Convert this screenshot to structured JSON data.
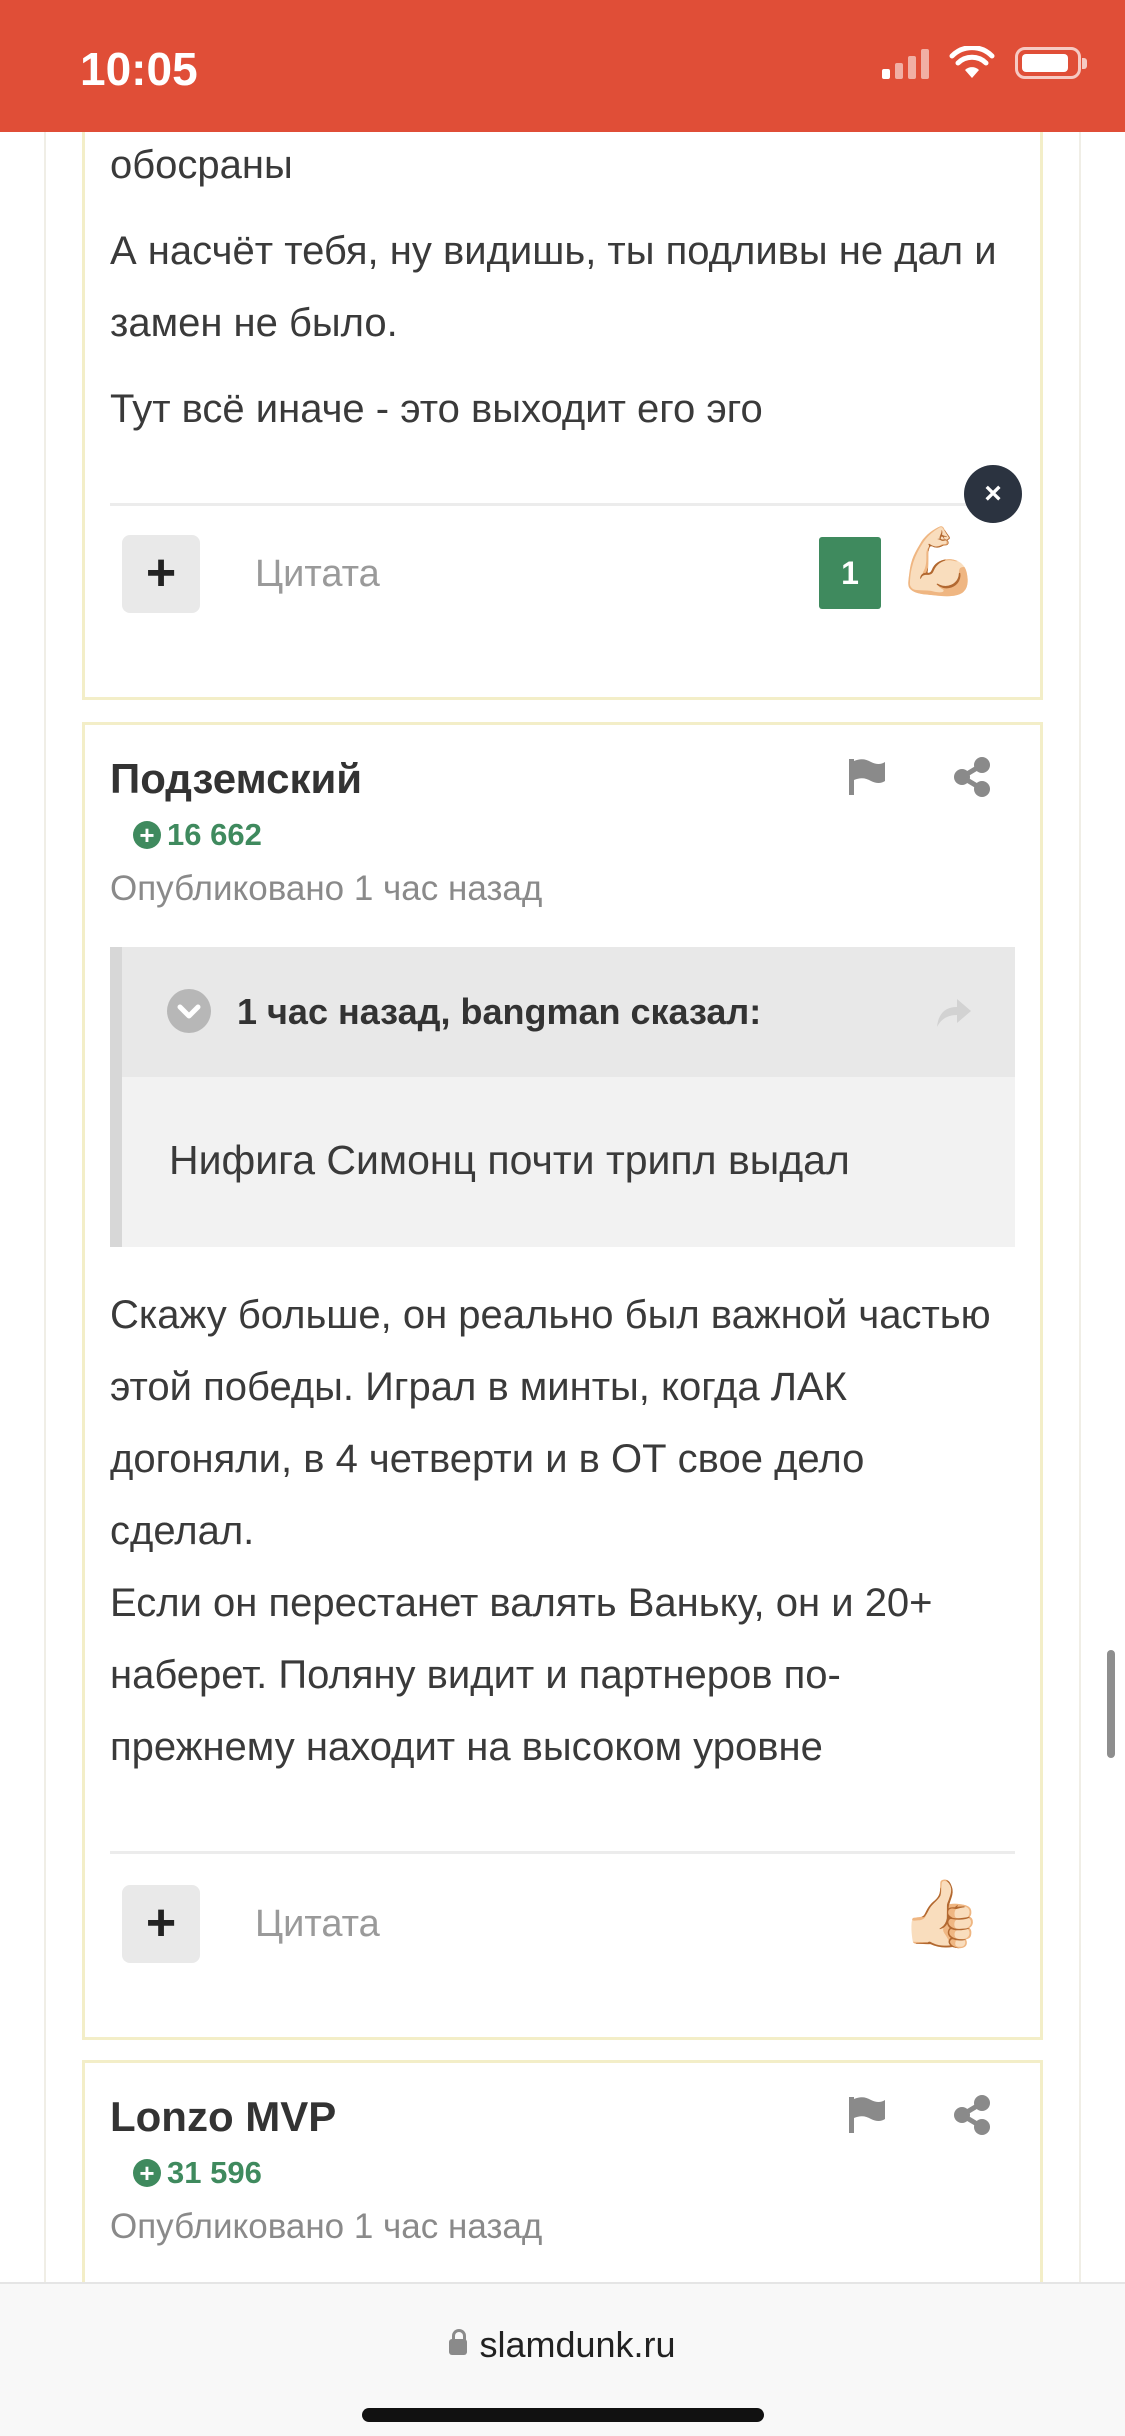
{
  "status_bar": {
    "time": "10:05"
  },
  "posts": [
    {
      "paragraphs": [
        "обосраны",
        "А насчёт тебя, ну видишь, ты подливы не дал и замен не было.",
        "Тут всё иначе - это выходит его эго"
      ],
      "quote_label": "Цитата",
      "reaction_count": "1",
      "reaction_emoji": "💪🏻",
      "close_symbol": "×"
    },
    {
      "author": "Подземский",
      "reputation": "16 662",
      "posted": "Опубликовано 1 час назад",
      "quote": {
        "header": "1 час назад, bangman сказал:",
        "text": "Нифига Симонц почти трипл выдал"
      },
      "paragraphs": [
        "Скажу больше, он реально был важной частью этой победы. Играл в минты, когда ЛАК догоняли, в 4 четверти и в ОТ свое дело сделал.",
        "Если он перестанет валять Ваньку, он и 20+ наберет. Поляну видит и партнеров по-прежнему находит на высоком уровне"
      ],
      "quote_label": "Цитата",
      "reaction_emoji": "👍🏻"
    },
    {
      "author": "Lonzo MVP",
      "reputation": "31 596",
      "posted": "Опубликовано 1 час назад"
    }
  ],
  "browser": {
    "url": "slamdunk.ru"
  },
  "colors": {
    "accent": "#e04e37",
    "reputation": "#3f8a5e",
    "post_border": "#f3eec8"
  }
}
